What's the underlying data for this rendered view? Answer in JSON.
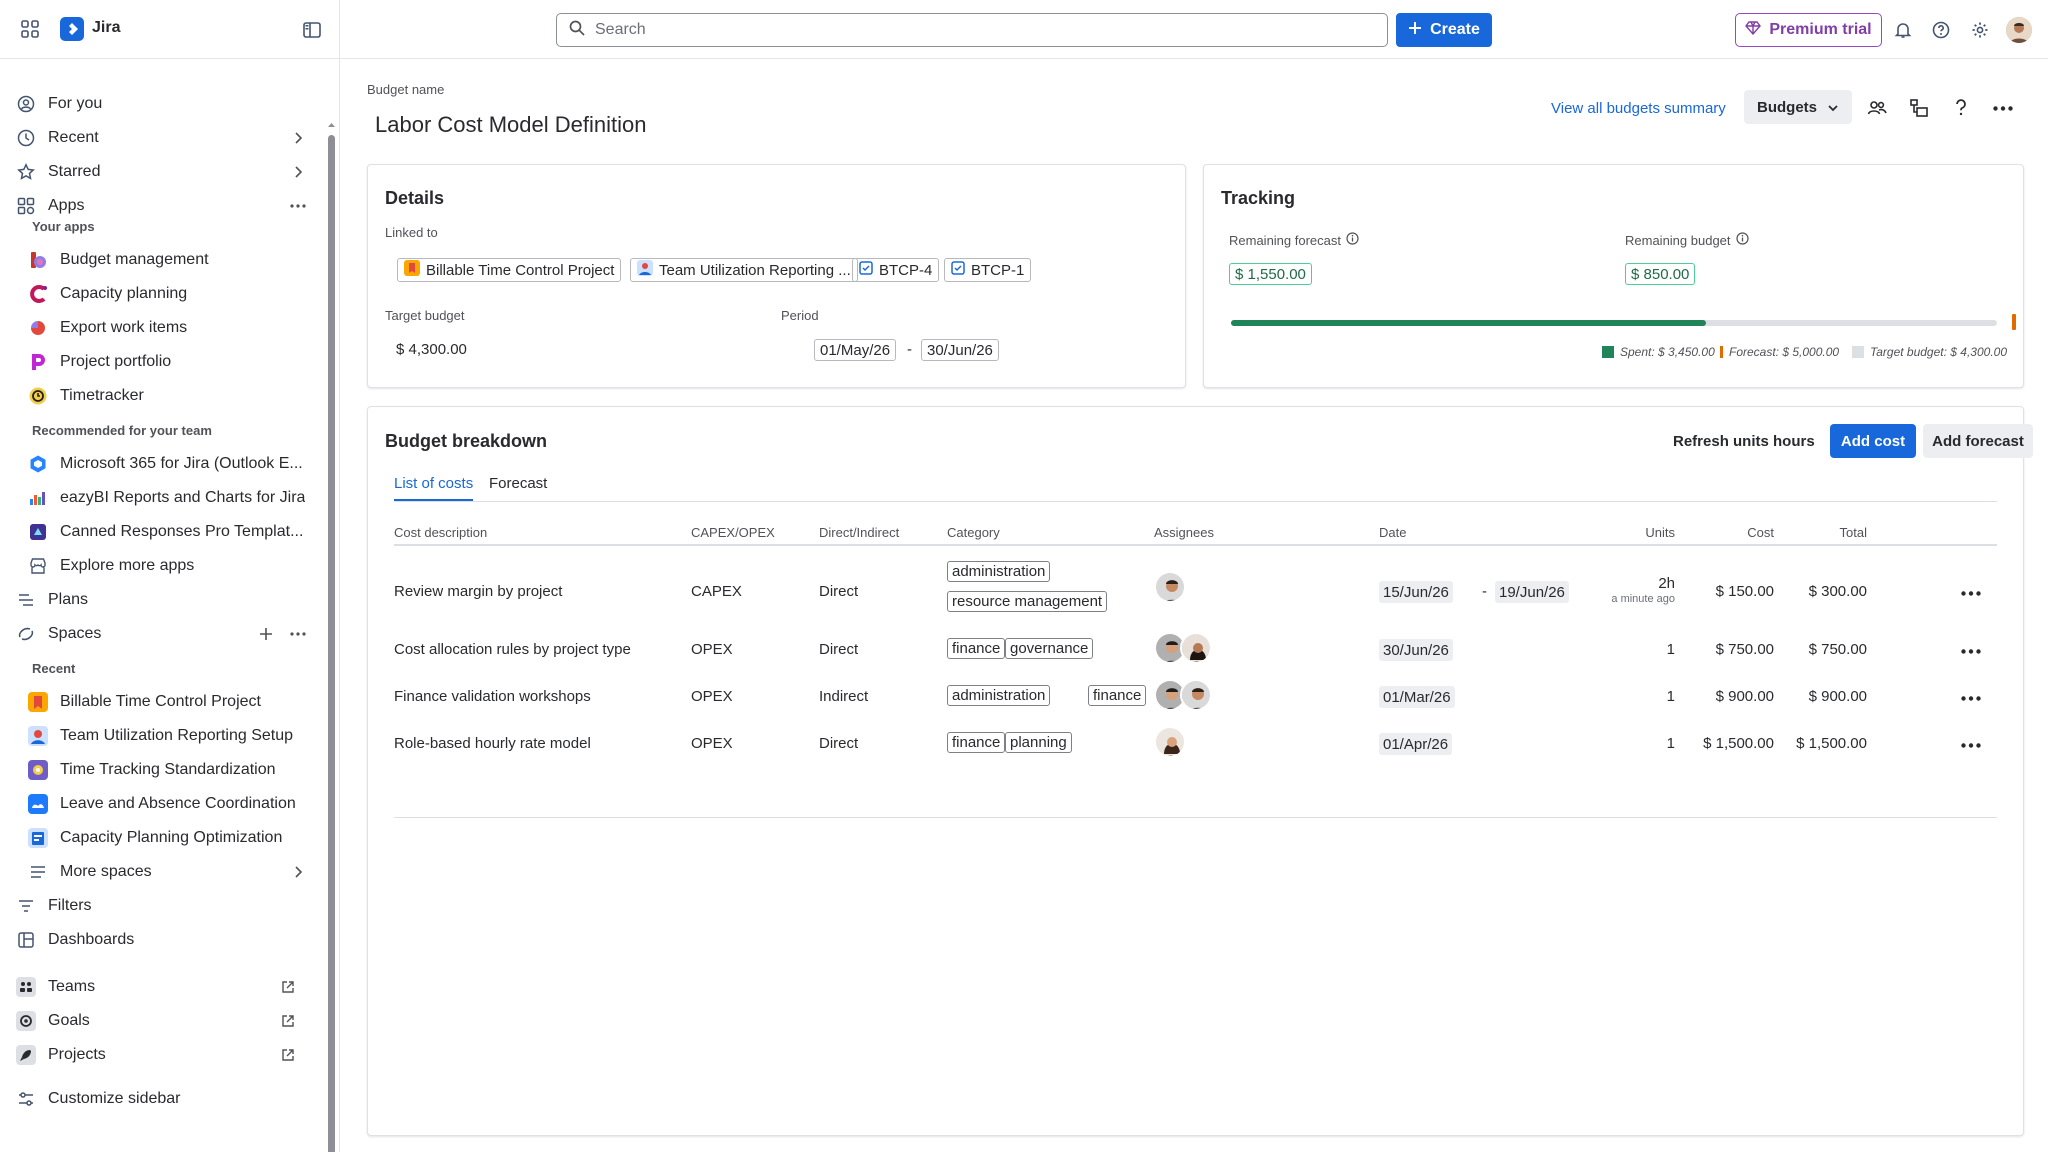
{
  "topbar": {
    "app_name": "Jira",
    "search_placeholder": "Search",
    "create_label": "Create",
    "premium_label": "Premium trial"
  },
  "sidebar": {
    "for_you": "For you",
    "recent": "Recent",
    "starred": "Starred",
    "apps": "Apps",
    "your_apps_heading": "Your apps",
    "your_apps": [
      "Budget management",
      "Capacity planning",
      "Export work items",
      "Project portfolio",
      "Timetracker"
    ],
    "recommended_heading": "Recommended for your team",
    "recommended": [
      "Microsoft 365 for Jira (Outlook E...",
      "eazyBI Reports and Charts for Jira",
      "Canned Responses Pro Templat...",
      "Explore more apps"
    ],
    "plans": "Plans",
    "spaces": "Spaces",
    "recent_heading": "Recent",
    "recent_spaces": [
      "Billable Time Control Project",
      "Team Utilization Reporting Setup",
      "Time Tracking Standardization",
      "Leave and Absence Coordination",
      "Capacity Planning Optimization"
    ],
    "more_spaces": "More spaces",
    "filters": "Filters",
    "dashboards": "Dashboards",
    "teams": "Teams",
    "goals": "Goals",
    "projects": "Projects",
    "customize": "Customize sidebar"
  },
  "header": {
    "budget_name_label": "Budget name",
    "title": "Labor Cost Model Definition",
    "view_all_link": "View all budgets summary",
    "budgets_button": "Budgets"
  },
  "details": {
    "title": "Details",
    "linked_to_label": "Linked to",
    "linked": [
      "Billable Time Control Project",
      "Team Utilization Reporting ...",
      "BTCP-4",
      "BTCP-1"
    ],
    "target_budget_label": "Target budget",
    "target_budget_value": "$ 4,300.00",
    "period_label": "Period",
    "period_start": "01/May/26",
    "period_sep": "-",
    "period_end": "30/Jun/26"
  },
  "tracking": {
    "title": "Tracking",
    "remaining_forecast_label": "Remaining forecast",
    "remaining_forecast_value": "$ 1,550.00",
    "remaining_budget_label": "Remaining budget",
    "remaining_budget_value": "$ 850.00",
    "spent_fraction": 0.62,
    "legend_spent": "Spent: $ 3,450.00",
    "legend_forecast": "Forecast: $ 5,000.00",
    "legend_target": "Target budget: $ 4,300.00",
    "colors": {
      "spent": "#1f845a",
      "forecast": "#e06c00",
      "target": "#dcdfe4"
    }
  },
  "breakdown": {
    "title": "Budget breakdown",
    "refresh_label": "Refresh units hours",
    "add_cost_label": "Add cost",
    "add_forecast_label": "Add forecast",
    "tabs": [
      "List of costs",
      "Forecast"
    ],
    "columns": [
      "Cost description",
      "CAPEX/OPEX",
      "Direct/Indirect",
      "Category",
      "Assignees",
      "Date",
      "Units",
      "Cost",
      "Total"
    ],
    "rows": [
      {
        "description": "Review margin by project",
        "capex": "CAPEX",
        "direct": "Direct",
        "categories": [
          "administration",
          "resource management"
        ],
        "date_start": "15/Jun/26",
        "date_sep": "-",
        "date_end": "19/Jun/26",
        "units": "2h",
        "units_note": "a minute ago",
        "cost": "$ 150.00",
        "total": "$ 300.00"
      },
      {
        "description": "Cost allocation rules by project type",
        "capex": "OPEX",
        "direct": "Direct",
        "categories": [
          "finance",
          "governance"
        ],
        "date_start": "30/Jun/26",
        "units": "1",
        "cost": "$ 750.00",
        "total": "$ 750.00"
      },
      {
        "description": "Finance validation workshops",
        "capex": "OPEX",
        "direct": "Indirect",
        "categories": [
          "administration",
          "finance"
        ],
        "date_start": "01/Mar/26",
        "units": "1",
        "cost": "$ 900.00",
        "total": "$ 900.00"
      },
      {
        "description": "Role-based hourly rate model",
        "capex": "OPEX",
        "direct": "Direct",
        "categories": [
          "finance",
          "planning"
        ],
        "date_start": "01/Apr/26",
        "units": "1",
        "cost": "$ 1,500.00",
        "total": "$ 1,500.00"
      }
    ]
  }
}
